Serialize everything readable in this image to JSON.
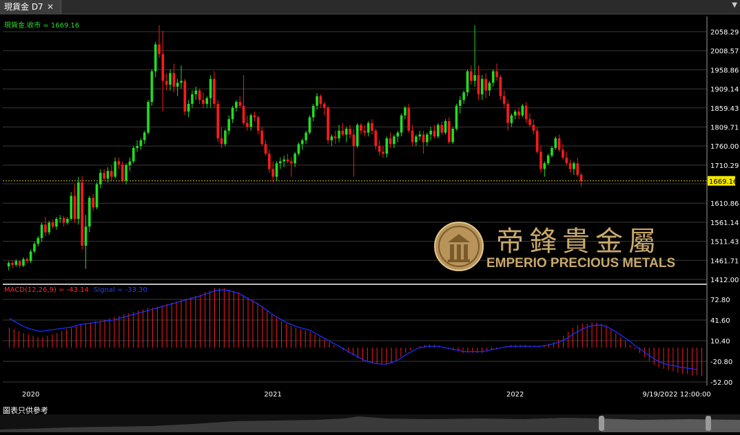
{
  "tab": {
    "title": "現貨金 D7",
    "close": "✕"
  },
  "menu_arrow": "▼",
  "price_legend": {
    "text": "現貨金.收市 = 1669.16"
  },
  "macd_legend": {
    "label": "MACD(12,26,9) = -43.14",
    "signal": "Signal = -33.30"
  },
  "footer_text": "圖表只供參考",
  "logo": {
    "chinese": "帝鋒貴金屬",
    "english": "EMPERIO PRECIOUS METALS"
  },
  "colors": {
    "up": "#22dd22",
    "down": "#ff1a1a",
    "signal": "#1a2fff",
    "grid": "#3a3a3a",
    "current": "#d4c400",
    "logo": "#c9a96a"
  },
  "chart_data": [
    {
      "type": "candlestick",
      "series_name": "現貨金.收市",
      "current_price": 1669.16,
      "current_label": "1669.16",
      "ylim": [
        1412.0,
        2083.15
      ],
      "yticks": [
        2058.29,
        2008.57,
        1958.86,
        1909.14,
        1859.43,
        1809.71,
        1760.0,
        1710.29,
        1661.57,
        1610.86,
        1561.14,
        1511.43,
        1461.71,
        1412.0
      ],
      "ytick_labels": [
        "2058.29",
        "2008.57",
        "1958.86",
        "1909.14",
        "1859.43",
        "1809.71",
        "1760.00",
        "1710.29",
        "",
        "1610.86",
        "1561.14",
        "1511.43",
        "1461.71",
        "1412.00"
      ],
      "xticks": [
        {
          "label": "2020",
          "index": 6
        },
        {
          "label": "2021",
          "index": 72
        },
        {
          "label": "2022",
          "index": 138
        },
        {
          "label": "9/19/2022 12:00:00",
          "index": 182
        }
      ],
      "candles": [
        [
          1446,
          1460,
          1436,
          1455
        ],
        [
          1455,
          1462,
          1442,
          1450
        ],
        [
          1450,
          1465,
          1445,
          1460
        ],
        [
          1460,
          1460,
          1442,
          1448
        ],
        [
          1448,
          1470,
          1444,
          1465
        ],
        [
          1465,
          1470,
          1455,
          1460
        ],
        [
          1460,
          1490,
          1455,
          1485
        ],
        [
          1485,
          1510,
          1480,
          1505
        ],
        [
          1505,
          1525,
          1498,
          1520
        ],
        [
          1520,
          1560,
          1510,
          1555
        ],
        [
          1555,
          1575,
          1525,
          1535
        ],
        [
          1535,
          1565,
          1528,
          1560
        ],
        [
          1560,
          1568,
          1545,
          1550
        ],
        [
          1550,
          1575,
          1542,
          1570
        ],
        [
          1570,
          1580,
          1560,
          1572
        ],
        [
          1572,
          1578,
          1550,
          1560
        ],
        [
          1560,
          1575,
          1555,
          1570
        ],
        [
          1570,
          1640,
          1565,
          1630
        ],
        [
          1630,
          1660,
          1560,
          1570
        ],
        [
          1570,
          1680,
          1555,
          1665
        ],
        [
          1665,
          1682,
          1490,
          1500
        ],
        [
          1500,
          1580,
          1440,
          1550
        ],
        [
          1550,
          1630,
          1535,
          1625
        ],
        [
          1625,
          1635,
          1590,
          1600
        ],
        [
          1600,
          1665,
          1595,
          1660
        ],
        [
          1660,
          1700,
          1650,
          1690
        ],
        [
          1690,
          1700,
          1670,
          1675
        ],
        [
          1675,
          1705,
          1665,
          1695
        ],
        [
          1695,
          1710,
          1670,
          1680
        ],
        [
          1680,
          1730,
          1675,
          1720
        ],
        [
          1720,
          1730,
          1700,
          1712
        ],
        [
          1712,
          1720,
          1665,
          1670
        ],
        [
          1670,
          1715,
          1660,
          1710
        ],
        [
          1710,
          1730,
          1695,
          1720
        ],
        [
          1720,
          1760,
          1715,
          1755
        ],
        [
          1755,
          1775,
          1745,
          1760
        ],
        [
          1760,
          1780,
          1750,
          1775
        ],
        [
          1775,
          1800,
          1765,
          1795
        ],
        [
          1795,
          1880,
          1790,
          1875
        ],
        [
          1875,
          1960,
          1865,
          1955
        ],
        [
          1955,
          2032,
          1940,
          2025
        ],
        [
          2025,
          2075,
          1990,
          2000
        ],
        [
          2000,
          2060,
          1850,
          1930
        ],
        [
          1930,
          1950,
          1905,
          1920
        ],
        [
          1920,
          1960,
          1905,
          1950
        ],
        [
          1950,
          1975,
          1900,
          1915
        ],
        [
          1915,
          1935,
          1890,
          1925
        ],
        [
          1925,
          1970,
          1910,
          1930
        ],
        [
          1930,
          1935,
          1840,
          1850
        ],
        [
          1850,
          1880,
          1835,
          1870
        ],
        [
          1870,
          1905,
          1860,
          1895
        ],
        [
          1895,
          1915,
          1880,
          1905
        ],
        [
          1905,
          1910,
          1870,
          1880
        ],
        [
          1880,
          1900,
          1860,
          1870
        ],
        [
          1870,
          1890,
          1860,
          1885
        ],
        [
          1885,
          1945,
          1860,
          1935
        ],
        [
          1935,
          1955,
          1860,
          1870
        ],
        [
          1870,
          1880,
          1770,
          1780
        ],
        [
          1780,
          1810,
          1755,
          1765
        ],
        [
          1765,
          1805,
          1760,
          1800
        ],
        [
          1800,
          1840,
          1790,
          1830
        ],
        [
          1830,
          1865,
          1820,
          1860
        ],
        [
          1860,
          1880,
          1850,
          1875
        ],
        [
          1875,
          1890,
          1860,
          1865
        ],
        [
          1865,
          1945,
          1815,
          1820
        ],
        [
          1820,
          1840,
          1800,
          1810
        ],
        [
          1810,
          1845,
          1800,
          1840
        ],
        [
          1840,
          1850,
          1825,
          1835
        ],
        [
          1835,
          1840,
          1790,
          1800
        ],
        [
          1800,
          1810,
          1760,
          1765
        ],
        [
          1765,
          1775,
          1735,
          1740
        ],
        [
          1740,
          1750,
          1690,
          1700
        ],
        [
          1700,
          1720,
          1665,
          1680
        ],
        [
          1680,
          1720,
          1670,
          1715
        ],
        [
          1715,
          1730,
          1700,
          1720
        ],
        [
          1720,
          1735,
          1705,
          1725
        ],
        [
          1725,
          1740,
          1715,
          1720
        ],
        [
          1720,
          1730,
          1680,
          1715
        ],
        [
          1715,
          1745,
          1705,
          1740
        ],
        [
          1740,
          1770,
          1735,
          1765
        ],
        [
          1765,
          1780,
          1750,
          1775
        ],
        [
          1775,
          1800,
          1765,
          1795
        ],
        [
          1795,
          1840,
          1790,
          1835
        ],
        [
          1835,
          1870,
          1825,
          1865
        ],
        [
          1865,
          1898,
          1855,
          1890
        ],
        [
          1890,
          1895,
          1860,
          1870
        ],
        [
          1870,
          1875,
          1840,
          1860
        ],
        [
          1860,
          1865,
          1765,
          1775
        ],
        [
          1775,
          1790,
          1760,
          1785
        ],
        [
          1785,
          1800,
          1765,
          1780
        ],
        [
          1780,
          1815,
          1770,
          1800
        ],
        [
          1800,
          1820,
          1785,
          1790
        ],
        [
          1790,
          1810,
          1770,
          1805
        ],
        [
          1805,
          1815,
          1780,
          1790
        ],
        [
          1790,
          1805,
          1680,
          1760
        ],
        [
          1760,
          1820,
          1755,
          1815
        ],
        [
          1815,
          1820,
          1790,
          1800
        ],
        [
          1800,
          1815,
          1785,
          1795
        ],
        [
          1795,
          1825,
          1785,
          1820
        ],
        [
          1820,
          1830,
          1790,
          1800
        ],
        [
          1800,
          1805,
          1750,
          1760
        ],
        [
          1760,
          1775,
          1735,
          1745
        ],
        [
          1745,
          1760,
          1730,
          1740
        ],
        [
          1740,
          1785,
          1730,
          1780
        ],
        [
          1780,
          1795,
          1755,
          1765
        ],
        [
          1765,
          1790,
          1755,
          1785
        ],
        [
          1785,
          1800,
          1770,
          1795
        ],
        [
          1795,
          1845,
          1785,
          1840
        ],
        [
          1840,
          1865,
          1830,
          1860
        ],
        [
          1860,
          1870,
          1795,
          1800
        ],
        [
          1800,
          1815,
          1760,
          1770
        ],
        [
          1770,
          1790,
          1760,
          1785
        ],
        [
          1785,
          1800,
          1775,
          1790
        ],
        [
          1790,
          1800,
          1740,
          1770
        ],
        [
          1770,
          1795,
          1760,
          1790
        ],
        [
          1790,
          1810,
          1775,
          1800
        ],
        [
          1800,
          1815,
          1780,
          1785
        ],
        [
          1785,
          1820,
          1780,
          1815
        ],
        [
          1815,
          1825,
          1790,
          1795
        ],
        [
          1795,
          1830,
          1790,
          1825
        ],
        [
          1825,
          1835,
          1765,
          1770
        ],
        [
          1770,
          1810,
          1765,
          1805
        ],
        [
          1805,
          1870,
          1800,
          1865
        ],
        [
          1865,
          1890,
          1845,
          1880
        ],
        [
          1880,
          1905,
          1870,
          1900
        ],
        [
          1900,
          1960,
          1890,
          1955
        ],
        [
          1955,
          1970,
          1920,
          1930
        ],
        [
          1930,
          2075,
          1915,
          1945
        ],
        [
          1945,
          1970,
          1880,
          1895
        ],
        [
          1895,
          1945,
          1880,
          1935
        ],
        [
          1935,
          1950,
          1885,
          1905
        ],
        [
          1905,
          1930,
          1890,
          1925
        ],
        [
          1925,
          1960,
          1915,
          1955
        ],
        [
          1955,
          1975,
          1930,
          1940
        ],
        [
          1940,
          1945,
          1880,
          1890
        ],
        [
          1890,
          1905,
          1860,
          1870
        ],
        [
          1870,
          1880,
          1800,
          1820
        ],
        [
          1820,
          1845,
          1810,
          1840
        ],
        [
          1840,
          1855,
          1830,
          1850
        ],
        [
          1850,
          1860,
          1830,
          1840
        ],
        [
          1840,
          1870,
          1835,
          1865
        ],
        [
          1865,
          1875,
          1820,
          1830
        ],
        [
          1830,
          1845,
          1810,
          1815
        ],
        [
          1815,
          1830,
          1790,
          1800
        ],
        [
          1800,
          1810,
          1740,
          1745
        ],
        [
          1745,
          1760,
          1690,
          1700
        ],
        [
          1700,
          1720,
          1680,
          1715
        ],
        [
          1715,
          1740,
          1710,
          1735
        ],
        [
          1735,
          1760,
          1730,
          1755
        ],
        [
          1755,
          1785,
          1750,
          1780
        ],
        [
          1780,
          1790,
          1745,
          1750
        ],
        [
          1750,
          1765,
          1725,
          1730
        ],
        [
          1730,
          1745,
          1710,
          1715
        ],
        [
          1715,
          1725,
          1690,
          1700
        ],
        [
          1700,
          1720,
          1685,
          1715
        ],
        [
          1715,
          1730,
          1680,
          1685
        ],
        [
          1685,
          1690,
          1655,
          1669.16
        ]
      ]
    },
    {
      "type": "bar+line",
      "name": "MACD(12,26,9)",
      "macd_value": -43.14,
      "signal_value": -33.3,
      "ylim": [
        -64.0,
        90.0
      ],
      "yticks": [
        72.8,
        41.6,
        10.4,
        -20.8,
        -52.0
      ],
      "ytick_labels": [
        "72.80",
        "41.60",
        "10.40",
        "-20.80",
        "-52.00"
      ],
      "macd": [
        30,
        28,
        25,
        22,
        20,
        18,
        16,
        16,
        18,
        20,
        22,
        25,
        28,
        30,
        32,
        35,
        36,
        38,
        40,
        40,
        42,
        44,
        46,
        48,
        50,
        52,
        54,
        56,
        58,
        60,
        60,
        62,
        64,
        66,
        68,
        70,
        72,
        74,
        76,
        78,
        80,
        84,
        86,
        90,
        90,
        90,
        88,
        86,
        84,
        80,
        76,
        72,
        68,
        62,
        56,
        50,
        45,
        40,
        36,
        32,
        30,
        28,
        26,
        24,
        20,
        16,
        12,
        8,
        4,
        0,
        -4,
        -8,
        -12,
        -16,
        -20,
        -22,
        -24,
        -25,
        -26,
        -26,
        -24,
        -20,
        -14,
        -8,
        -4,
        0,
        2,
        4,
        4,
        4,
        2,
        0,
        -2,
        -4,
        -6,
        -8,
        -8,
        -8,
        -8,
        -8,
        -6,
        -4,
        -2,
        0,
        2,
        4,
        4,
        4,
        4,
        2,
        2,
        2,
        4,
        6,
        8,
        12,
        18,
        24,
        30,
        34,
        36,
        36,
        38,
        38,
        36,
        34,
        28,
        22,
        16,
        10,
        4,
        -2,
        -8,
        -14,
        -20,
        -26,
        -30,
        -32,
        -34,
        -36,
        -38,
        -40,
        -40,
        -42,
        -42,
        -43.14
      ],
      "signal": [
        44,
        40,
        36,
        32,
        29,
        27,
        25,
        25,
        26,
        27,
        28,
        29,
        30,
        31,
        33,
        35,
        36,
        37,
        38,
        39,
        40,
        41,
        42,
        44,
        46,
        48,
        50,
        52,
        54,
        56,
        58,
        60,
        62,
        64,
        66,
        68,
        70,
        72,
        74,
        76,
        78,
        81,
        83,
        86,
        87,
        87,
        86,
        84,
        82,
        78,
        74,
        70,
        66,
        61,
        56,
        51,
        46,
        42,
        38,
        35,
        32,
        30,
        28,
        26,
        22,
        18,
        14,
        10,
        6,
        2,
        -2,
        -6,
        -10,
        -14,
        -18,
        -21,
        -23,
        -24,
        -25,
        -25,
        -23,
        -20,
        -16,
        -11,
        -7,
        -3,
        0,
        1,
        2,
        2,
        2,
        0,
        -1,
        -3,
        -4,
        -6,
        -6,
        -6,
        -6,
        -6,
        -5,
        -3,
        -2,
        0,
        1,
        2,
        2,
        2,
        2,
        2,
        2,
        2,
        3,
        4,
        6,
        8,
        11,
        15,
        20,
        24,
        28,
        31,
        33,
        34,
        34,
        32,
        28,
        24,
        19,
        14,
        9,
        3,
        -2,
        -7,
        -12,
        -17,
        -21,
        -24,
        -26,
        -27,
        -29,
        -30,
        -31,
        -32,
        -33.3
      ]
    }
  ]
}
